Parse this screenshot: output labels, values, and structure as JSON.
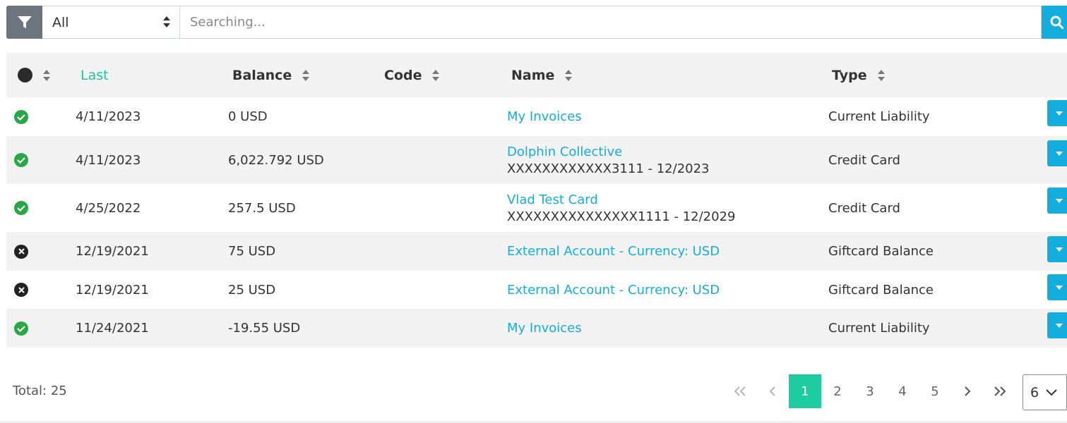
{
  "search": {
    "filter_icon": "filter-icon",
    "select_value": "All",
    "placeholder": "Searching...",
    "search_icon": "search-icon"
  },
  "table": {
    "headers": {
      "status_icon": "status-dot-icon",
      "last": "Last",
      "balance": "Balance",
      "code": "Code",
      "name": "Name",
      "type": "Type"
    },
    "rows": [
      {
        "status": "active",
        "last": "4/11/2023",
        "balance": "0 USD",
        "code": "",
        "name": "My Invoices",
        "name_sub": "",
        "type": "Current Liability"
      },
      {
        "status": "active",
        "last": "4/11/2023",
        "balance": "6,022.792 USD",
        "code": "",
        "name": "Dolphin Collective",
        "name_sub": "XXXXXXXXXXXX3111 - 12/2023",
        "type": "Credit Card"
      },
      {
        "status": "active",
        "last": "4/25/2022",
        "balance": "257.5 USD",
        "code": "",
        "name": "Vlad Test Card",
        "name_sub": "XXXXXXXXXXXXXXX1111 - 12/2029",
        "type": "Credit Card"
      },
      {
        "status": "inactive",
        "last": "12/19/2021",
        "balance": "75 USD",
        "code": "",
        "name": "External Account - Currency: USD",
        "name_sub": "",
        "type": "Giftcard Balance"
      },
      {
        "status": "inactive",
        "last": "12/19/2021",
        "balance": "25 USD",
        "code": "",
        "name": "External Account - Currency: USD",
        "name_sub": "",
        "type": "Giftcard Balance"
      },
      {
        "status": "active",
        "last": "11/24/2021",
        "balance": "-19.55 USD",
        "code": "",
        "name": "My Invoices",
        "name_sub": "",
        "type": "Current Liability"
      }
    ]
  },
  "footer": {
    "total": "Total: 25",
    "pages": [
      "1",
      "2",
      "3",
      "4",
      "5"
    ],
    "current_page": "1",
    "per_page": "6"
  },
  "colors": {
    "accent": "#13aedd",
    "sorted_header": "#1bc59c",
    "active_page": "#1dcc9f",
    "status_ok": "#28a745"
  }
}
